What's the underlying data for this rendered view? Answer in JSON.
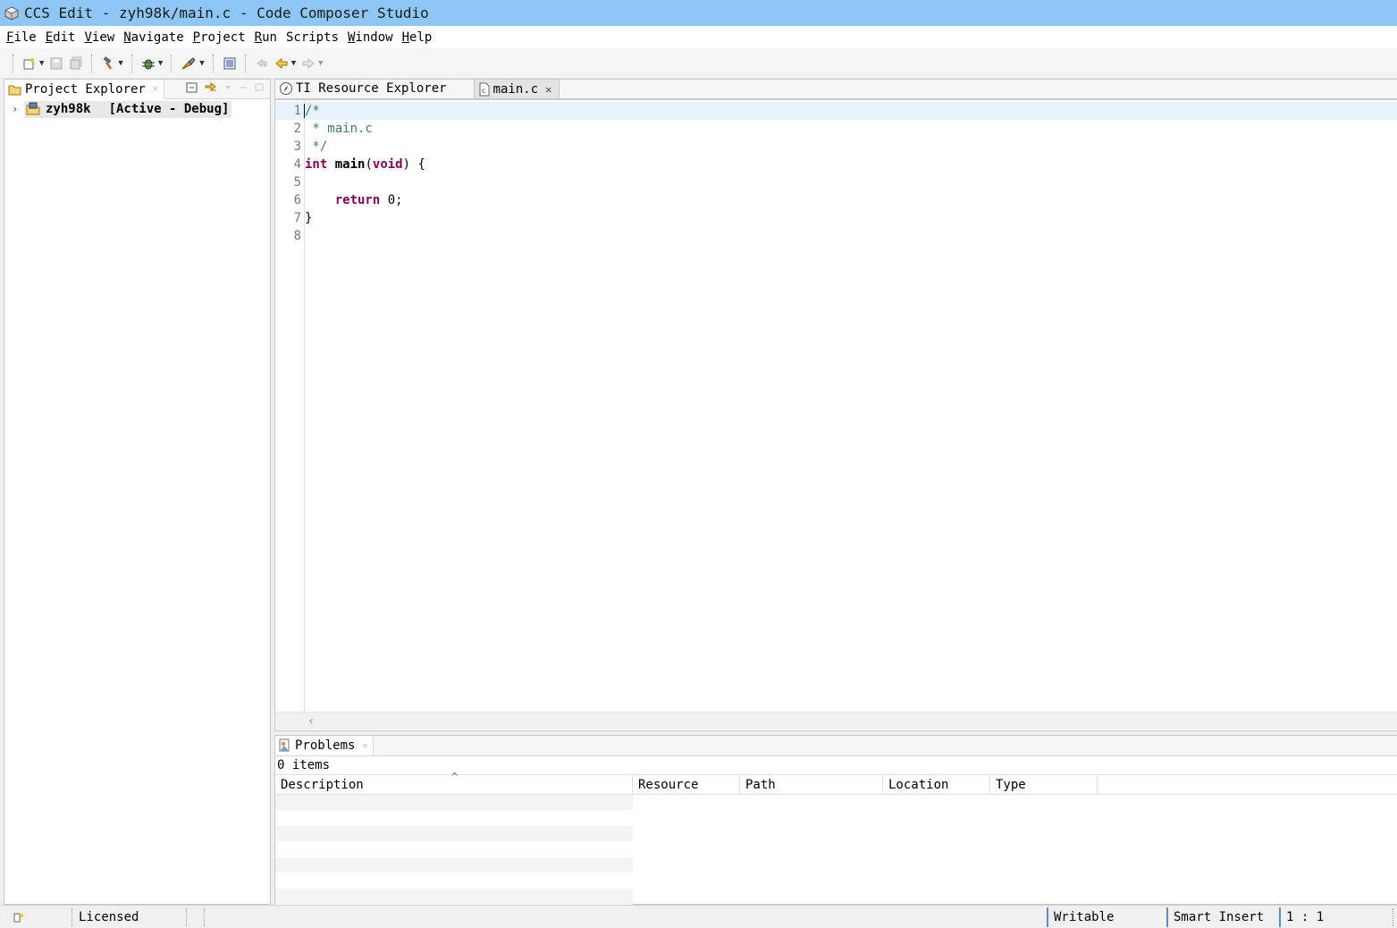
{
  "window": {
    "title": "CCS Edit - zyh98k/main.c - Code Composer Studio"
  },
  "menu": [
    {
      "first": "F",
      "rest": "ile"
    },
    {
      "first": "E",
      "rest": "dit"
    },
    {
      "first": "V",
      "rest": "iew"
    },
    {
      "first": "N",
      "rest": "avigate"
    },
    {
      "first": "P",
      "rest": "roject"
    },
    {
      "first": "R",
      "rest": "un"
    },
    {
      "first": "",
      "rest": "Scripts"
    },
    {
      "first": "W",
      "rest": "indow"
    },
    {
      "first": "H",
      "rest": "elp"
    }
  ],
  "project_explorer": {
    "tab_label": "Project Explorer",
    "project_name": "zyh98k",
    "project_status": "[Active - Debug]"
  },
  "editor": {
    "tabs": [
      "TI Resource Explorer",
      "main.c"
    ],
    "line_numbers": [
      "1",
      "2",
      "3",
      "4",
      "5",
      "6",
      "7",
      "8"
    ]
  },
  "problems": {
    "tab_label": "Problems",
    "count_text": "0 items",
    "columns": [
      "Description",
      "Resource",
      "Path",
      "Location",
      "Type"
    ]
  },
  "status": {
    "license": "Licensed",
    "writable": "Writable",
    "insert_mode": "Smart Insert",
    "position": "1 : 1"
  },
  "colors": {
    "titlebar": "#8ec7f5",
    "keyword": "#7f0055",
    "comment": "#3f7f5f",
    "current_line": "#e8f2fe"
  }
}
